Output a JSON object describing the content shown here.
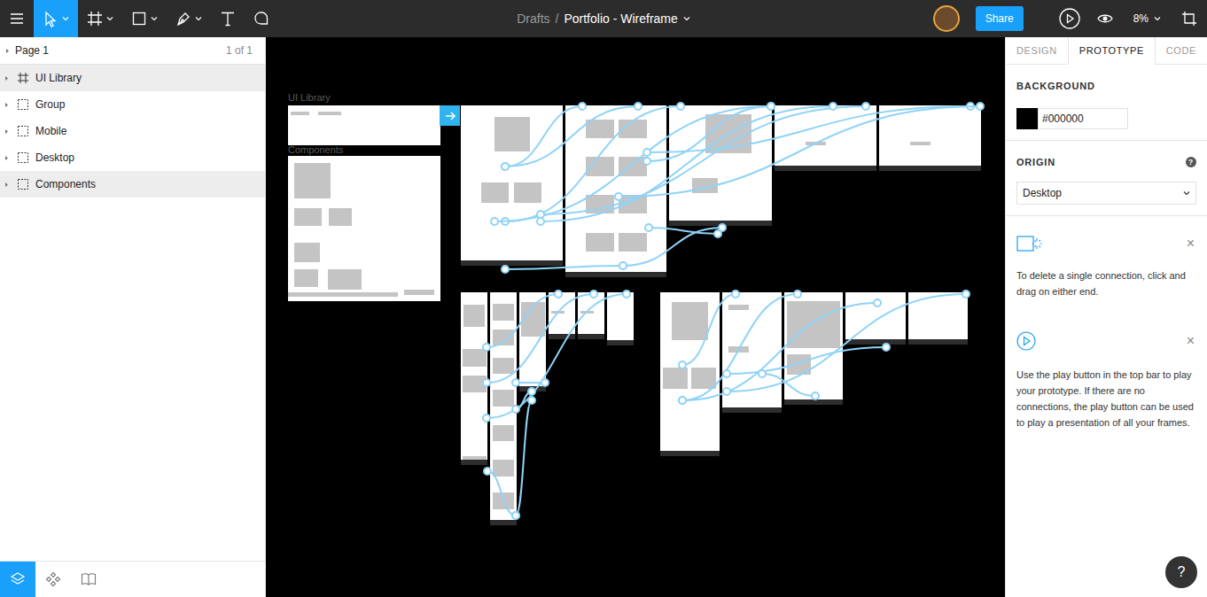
{
  "topbar": {
    "tools": [
      {
        "kind": "menu",
        "selected": false,
        "menu": false
      },
      {
        "kind": "move",
        "selected": true,
        "menu": true
      },
      {
        "kind": "frame",
        "selected": false,
        "menu": true
      },
      {
        "kind": "rect",
        "selected": false,
        "menu": true
      },
      {
        "kind": "pen",
        "selected": false,
        "menu": true
      },
      {
        "kind": "text",
        "selected": false,
        "menu": false
      },
      {
        "kind": "comment",
        "selected": false,
        "menu": false
      }
    ],
    "breadcrumb": "Drafts",
    "separator": "/",
    "file_title": "Portfolio - Wireframe",
    "share": "Share",
    "zoom": "8%"
  },
  "layers": {
    "page": "Page 1",
    "page_count": "1 of 1",
    "items": [
      {
        "label": "UI Library",
        "kind": "frame",
        "selected": true,
        "expanded": false
      },
      {
        "label": "Group",
        "kind": "group",
        "selected": false,
        "expanded": false
      },
      {
        "label": "Mobile",
        "kind": "group",
        "selected": false,
        "expanded": false
      },
      {
        "label": "Desktop",
        "kind": "group",
        "selected": false,
        "expanded": false
      },
      {
        "label": "Components",
        "kind": "group",
        "selected": true,
        "expanded": false
      }
    ]
  },
  "bottom_tabs": [
    {
      "kind": "layers",
      "selected": true
    },
    {
      "kind": "components",
      "selected": false
    },
    {
      "kind": "library",
      "selected": false
    }
  ],
  "canvas": {
    "labels": [
      "UI Library",
      "Components"
    ]
  },
  "panel": {
    "tabs": [
      {
        "label": "DESIGN",
        "selected": false
      },
      {
        "label": "PROTOTYPE",
        "selected": true
      },
      {
        "label": "CODE",
        "selected": false
      }
    ],
    "background_label": "BACKGROUND",
    "background_value": "#000000",
    "origin_label": "ORIGIN",
    "origin_help": "?",
    "origin_value": "Desktop",
    "tips": [
      {
        "kind": "connection",
        "text": "To delete a single connection, click and drag on either end.",
        "close": "×"
      },
      {
        "kind": "play",
        "text": "Use the play button in the top bar to play your prototype. If there are no connections, the play button can be used to play a presentation of all your frames.",
        "close": "×"
      }
    ]
  },
  "help": "?"
}
